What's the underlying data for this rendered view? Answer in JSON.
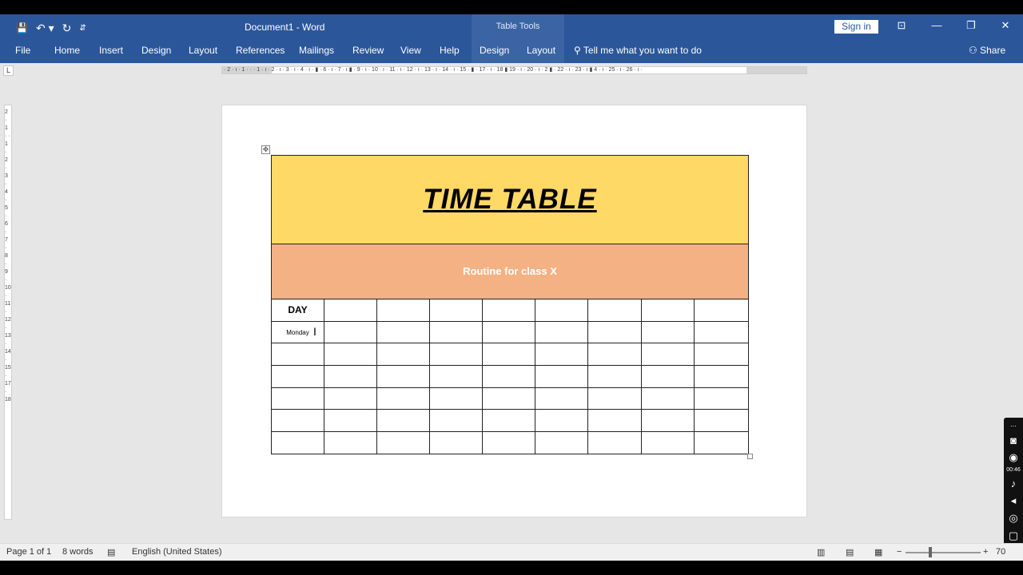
{
  "window": {
    "doc_title": "Document1  -  Word",
    "table_tools": "Table Tools",
    "sign_in": "Sign in",
    "minimize": "—",
    "restore": "❐",
    "close": "✕",
    "ribbon_display": "⊡"
  },
  "qat": {
    "save": "💾",
    "undo": "↶ ▾",
    "redo": "↻",
    "customize": "⇵"
  },
  "tabs": [
    "File",
    "Home",
    "Insert",
    "Design",
    "Layout",
    "References",
    "Mailings",
    "Review",
    "View",
    "Help",
    "Design",
    "Layout"
  ],
  "tell_me": "Tell me what you want to do",
  "share": "Share",
  "ruler": {
    "tab_selector": "L",
    "h_marks": "· 2 · ı · 1 · ·   · 1 · ı · 2 · ı · 3 · ı · 4 · ı · ▮ · 6 · ı · 7 · ı ▮ · 9 · ı · 10 · ı · 11 · ı · 12 · ı · 13 · ı · 14 · ı · 15 · ▮ · 17 · ı · 18 ▮ 19 · ı · 20 · ı · 2 ▮ · 22 · ı · 23 · ı ▮ 4 · ı · 25 · ı · 26 · ı ·",
    "v_marks": "2 · 1 · · 1 · 2 · 3 · 4 · 5 · 6 · 7 · 8 · 9 · 10 · 11 · 12 · 13 · 14 · 15 · 17 · 18"
  },
  "document": {
    "title": "TIME TABLE",
    "subtitle": "Routine for class X",
    "table": {
      "header": [
        "DAY",
        "",
        "",
        "",
        "",
        "",
        "",
        "",
        ""
      ],
      "rows": [
        [
          "Monday",
          "",
          "",
          "",
          "",
          "",
          "",
          "",
          ""
        ],
        [
          "",
          "",
          "",
          "",
          "",
          "",
          "",
          "",
          ""
        ],
        [
          "",
          "",
          "",
          "",
          "",
          "",
          "",
          "",
          ""
        ],
        [
          "",
          "",
          "",
          "",
          "",
          "",
          "",
          "",
          ""
        ],
        [
          "",
          "",
          "",
          "",
          "",
          "",
          "",
          "",
          ""
        ],
        [
          "",
          "",
          "",
          "",
          "",
          "",
          "",
          "",
          ""
        ]
      ]
    },
    "colors": {
      "title_fill": "#ffd966",
      "subtitle_fill": "#f4b183"
    }
  },
  "recorder": {
    "time": "00:46"
  },
  "status": {
    "page": "Page 1 of 1",
    "words": "8 words",
    "language": "English (United States)",
    "zoom": "70"
  },
  "theme": {
    "ribbon": "#2b579a"
  }
}
